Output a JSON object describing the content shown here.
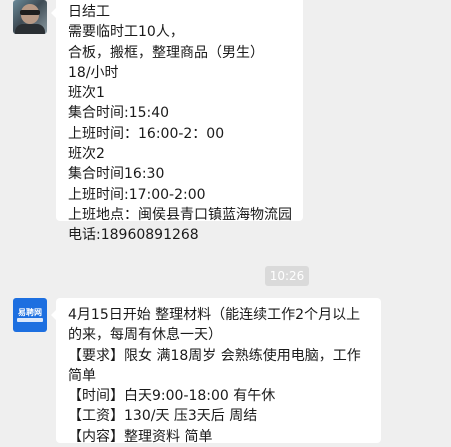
{
  "chat": {
    "messages": [
      {
        "sender_avatar": "user-photo-avatar",
        "lines": [
          "日结工",
          "需要临时工10人，",
          "合板，搬框，整理商品（男生）",
          "18/小时",
          "班次1",
          "集合时间:15:40",
          "上班时间：16:00-2：00",
          "班次2",
          "集合时间16:30",
          "上班时间:17:00-2:00",
          "上班地点：闽侯县青口镇蓝海物流园",
          "电话:18960891268"
        ]
      },
      {
        "sender_avatar": "company-logo-avatar",
        "logo_text": "易聘网",
        "lines": [
          "4月15日开始 整理材料（能连续工作2个月以上的来，每周有休息一天）",
          "【要求】限女 满18周岁 会熟练使用电脑，工作简单",
          "【时间】白天9:00-18:00 有午休",
          "【工资】130/天  压3天后 周结",
          "【内容】整理资料  简单"
        ]
      }
    ],
    "timestamp": "10:26"
  }
}
